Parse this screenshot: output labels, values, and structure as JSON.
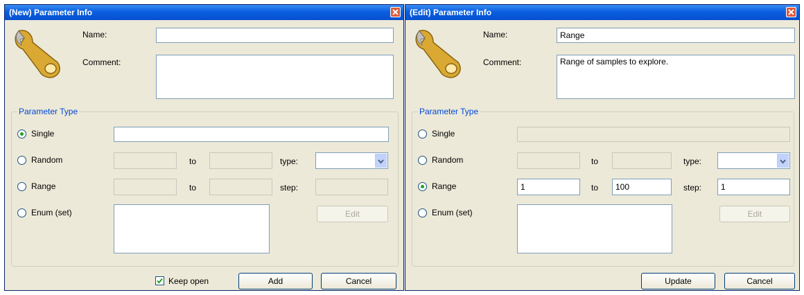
{
  "colors": {
    "title_bar": "#0a5fe0",
    "dialog_bg": "#ece9d8",
    "group_label": "#0046d5",
    "close": "#e05a3a"
  },
  "new_dialog": {
    "title": "(New) Parameter Info",
    "name_label": "Name:",
    "name_value": "",
    "comment_label": "Comment:",
    "comment_value": "",
    "group_label": "Parameter Type",
    "single_label": "Single",
    "random_label": "Random",
    "range_label": "Range",
    "enum_label": "Enum (set)",
    "to_label_1": "to",
    "to_label_2": "to",
    "type_label": "type:",
    "step_label": "step:",
    "selected_type": "Single",
    "single_value": "",
    "random_from": "",
    "random_to": "",
    "range_from": "",
    "range_to": "",
    "step_value": "",
    "edit_button": "Edit",
    "keep_open_label": "Keep open",
    "keep_open_checked": true,
    "add_button": "Add",
    "cancel_button": "Cancel"
  },
  "edit_dialog": {
    "title": "(Edit) Parameter Info",
    "name_label": "Name:",
    "name_value": "Range",
    "comment_label": "Comment:",
    "comment_value": "Range of samples to explore.",
    "group_label": "Parameter Type",
    "single_label": "Single",
    "random_label": "Random",
    "range_label": "Range",
    "enum_label": "Enum (set)",
    "to_label_1": "to",
    "to_label_2": "to",
    "type_label": "type:",
    "step_label": "step:",
    "selected_type": "Range",
    "single_value": "",
    "random_from": "",
    "random_to": "",
    "range_from": "1",
    "range_to": "100",
    "step_value": "1",
    "edit_button": "Edit",
    "update_button": "Update",
    "cancel_button": "Cancel"
  }
}
